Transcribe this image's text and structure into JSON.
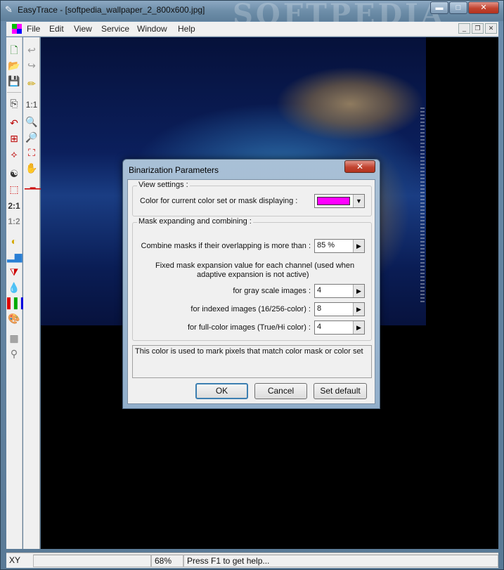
{
  "window": {
    "title": "EasyTrace - [softpedia_wallpaper_2_800x600.jpg]",
    "watermark": "SOFTPEDIA",
    "minimize": "▬",
    "maximize": "□",
    "close": "✕"
  },
  "menubar": {
    "items": [
      "File",
      "Edit",
      "View",
      "Service",
      "Window",
      "Help"
    ],
    "mdi_controls": [
      "_",
      "❐",
      "✕"
    ]
  },
  "toolbar_left": {
    "icons": [
      "new-icon",
      "open-icon",
      "save-icon",
      "copy-page-icon",
      "undo-icon",
      "crop-icon",
      "transform-icon",
      "yin-yang-icon",
      "select-rect-icon",
      "scale-2to1-icon",
      "scale-1to2-icon",
      "threshold-icon",
      "half-tone-icon",
      "histogram-icon",
      "filter-icon",
      "drop-icon",
      "color-bars-icon",
      "palette-icon",
      "checker-icon",
      "search-icon"
    ],
    "scale_2_1": "2:1",
    "scale_1_2": "1:2"
  },
  "toolbar_right": {
    "icons": [
      "undo-arrow-icon",
      "redo-arrow-icon",
      "pencil-icon",
      "zoom-actual-icon",
      "zoom-in-icon",
      "zoom-out-icon",
      "fit-window-icon",
      "hand-icon",
      "ruler-icon"
    ],
    "scale_1_1": "1:1"
  },
  "statusbar": {
    "coord_label": "XY",
    "coord_value": "",
    "zoom": "68%",
    "message": "Press F1 to get help..."
  },
  "dialog": {
    "title": "Binarization Parameters",
    "close": "✕",
    "view_settings": {
      "group_label": "View settings :",
      "color_label": "Color for current color set or mask displaying :",
      "color_value": "#ff00ff"
    },
    "mask_group": {
      "group_label": "Mask expanding and combining :",
      "combine_label": "Combine masks if their overlapping is more than :",
      "combine_value": "85 %",
      "fixed_note_line1": "Fixed mask expansion value for each channel (used when",
      "fixed_note_line2": "adaptive expansion is not active)",
      "gray_label": "for gray scale images :",
      "gray_value": "4",
      "indexed_label": "for indexed images (16/256-color) :",
      "indexed_value": "8",
      "fullcolor_label": "for full-color images (True/Hi color) :",
      "fullcolor_value": "4"
    },
    "description": "This color is used to mark pixels that match color mask or color set",
    "buttons": {
      "ok": "OK",
      "cancel": "Cancel",
      "set_default": "Set default"
    }
  }
}
